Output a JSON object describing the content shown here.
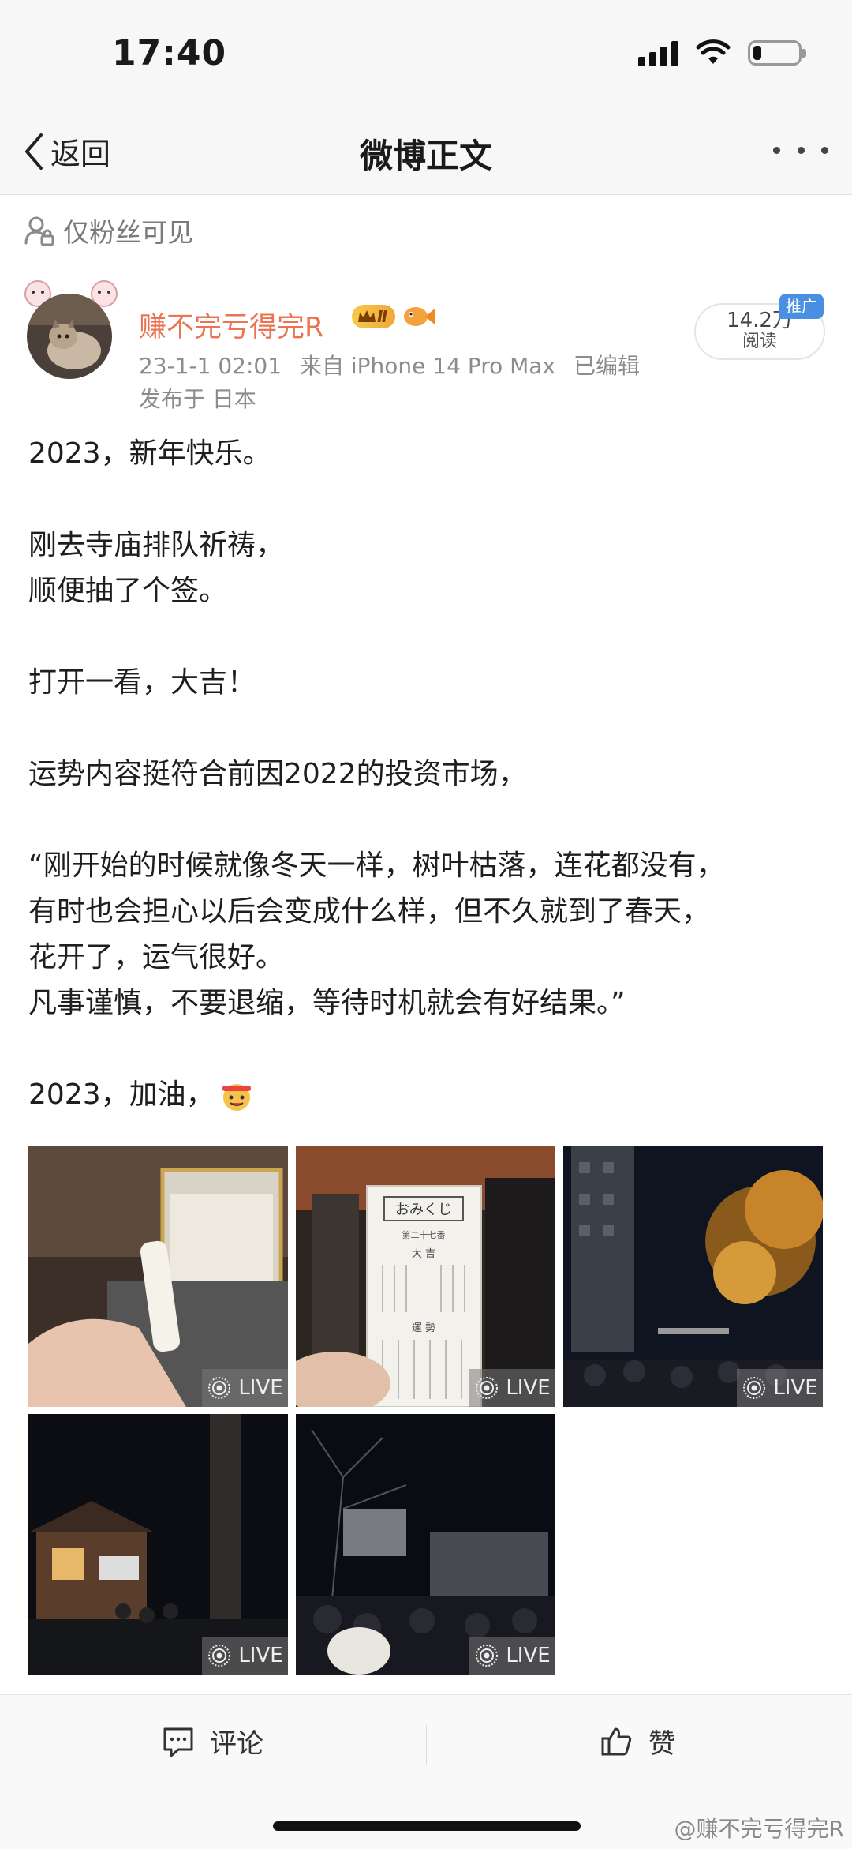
{
  "status_bar": {
    "time": "17:40",
    "battery_level": 0.18
  },
  "nav": {
    "back_label": "返回",
    "title": "微博正文"
  },
  "visibility": {
    "label": "仅粉丝可见"
  },
  "author": {
    "name": "赚不完亏得完R",
    "vip_level": "Ⅱ",
    "timestamp": "23-1-1 02:01",
    "source": "来自 iPhone 14 Pro Max",
    "edited": "已编辑",
    "location": "发布于 日本"
  },
  "stats": {
    "reads": "14.2万",
    "reads_label": "阅读",
    "promo_tag": "推广"
  },
  "post": {
    "lines": [
      "2023，新年快乐。",
      "",
      "刚去寺庙排队祈祷，",
      "顺便抽了个签。",
      "",
      "打开一看，大吉！",
      "",
      "运势内容挺符合前因2022的投资市场，",
      "",
      "“刚开始的时候就像冬天一样，树叶枯落，连花都没有，",
      "有时也会担心以后会变成什么样，但不久就到了春天，",
      "花开了，运气很好。",
      "凡事谨慎，不要退缩，等待时机就会有好结果。”",
      "",
      "2023，加油，"
    ]
  },
  "photos": [
    {
      "live_label": "LIVE"
    },
    {
      "live_label": "LIVE",
      "slip_title": "おみくじ",
      "slip_subtitle": "第二十七番",
      "slip_fortune": "大 吉",
      "slip_section": "運 勢"
    },
    {
      "live_label": "LIVE"
    },
    {
      "live_label": "LIVE"
    },
    {
      "live_label": "LIVE"
    }
  ],
  "actions": {
    "comment_label": "评论",
    "like_label": "赞"
  },
  "watermark": "@赚不完亏得完R",
  "colors": {
    "username": "#eb7350",
    "promo": "#4a90e2",
    "vip": "#f2a63a"
  }
}
